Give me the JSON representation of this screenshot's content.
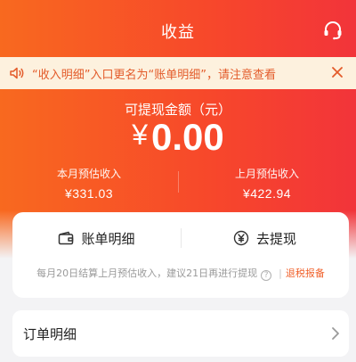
{
  "header": {
    "title": "收益",
    "service_icon": "headset-icon"
  },
  "notice": {
    "text": "“收入明细”入口更名为“账单明细”，请注意查看",
    "icon": "speaker-icon",
    "close_icon": "close-icon"
  },
  "balance": {
    "label": "可提现金额（元）",
    "currency": "¥",
    "amount": "0.00"
  },
  "stats": {
    "this_month_label": "本月预估收入",
    "this_month_value": "¥331.03",
    "last_month_label": "上月预估收入",
    "last_month_value": "¥422.94"
  },
  "actions": {
    "bill_details": "账单明细",
    "withdraw": "去提现",
    "hint": "每月20日结算上月预估收入，建议21日再进行提现",
    "hint_separator": "|",
    "tax_report": "退税报备"
  },
  "order": {
    "label": "订单明细"
  },
  "colors": {
    "brand_orange": "#f8691f",
    "brand_red": "#f2343a",
    "notice_bg": "#fdf1de",
    "notice_text": "#e35b2a",
    "link": "#f0622c"
  }
}
